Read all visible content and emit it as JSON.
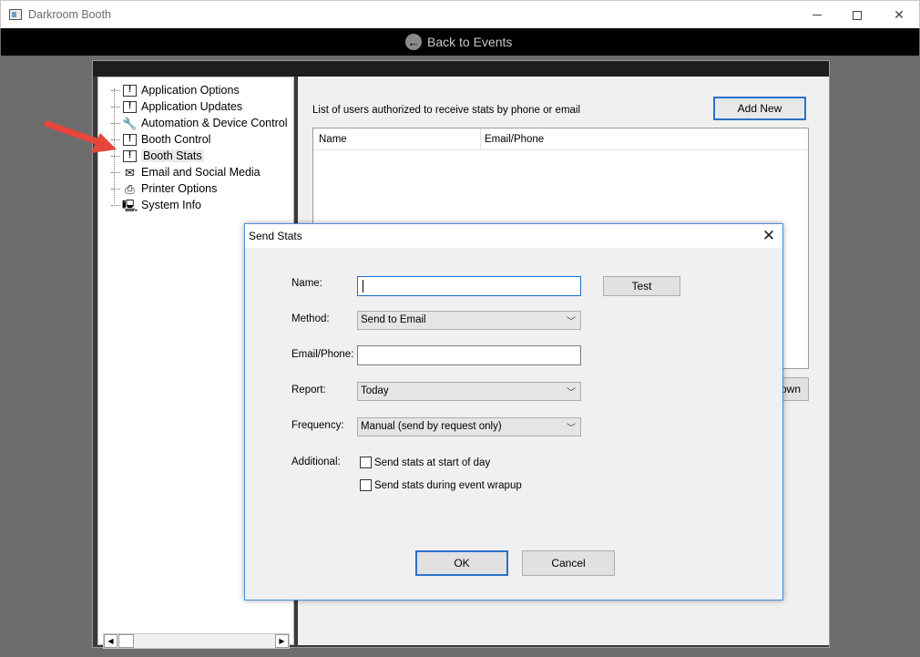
{
  "window": {
    "title": "Darkroom Booth",
    "minimize_icon": "minimize-icon",
    "maximize_icon": "maximize-icon",
    "close_icon": "close-icon"
  },
  "toolbar": {
    "back_label": "Back to Events",
    "back_icon": "back-arrow-icon"
  },
  "tree": {
    "items": [
      {
        "label": "Application Options",
        "icon": "info-icon"
      },
      {
        "label": "Application Updates",
        "icon": "info-icon"
      },
      {
        "label": "Automation & Device Control",
        "icon": "wrench-icon"
      },
      {
        "label": "Booth Control",
        "icon": "info-icon"
      },
      {
        "label": "Booth Stats",
        "icon": "info-icon",
        "selected": true
      },
      {
        "label": "Email and Social Media",
        "icon": "envelope-icon"
      },
      {
        "label": "Printer Options",
        "icon": "printer-icon"
      },
      {
        "label": "System Info",
        "icon": "computer-icon"
      }
    ]
  },
  "content": {
    "description": "List of users authorized to receive stats by phone or email",
    "add_new_label": "Add New",
    "columns": [
      "Name",
      "Email/Phone"
    ],
    "down_label": "own"
  },
  "dialog": {
    "title": "Send Stats",
    "name_label": "Name:",
    "name_value": "",
    "test_label": "Test",
    "method_label": "Method:",
    "method_value": "Send to Email",
    "email_label": "Email/Phone:",
    "email_value": "",
    "report_label": "Report:",
    "report_value": "Today",
    "frequency_label": "Frequency:",
    "frequency_value": "Manual (send by request only)",
    "additional_label": "Additional:",
    "check_start_label": "Send stats at start of day",
    "check_start_checked": false,
    "check_wrapup_label": "Send stats during event wrapup",
    "check_wrapup_checked": false,
    "ok_label": "OK",
    "cancel_label": "Cancel"
  },
  "colors": {
    "accent": "#2b72c8",
    "annotation_arrow": "#e8463a"
  }
}
